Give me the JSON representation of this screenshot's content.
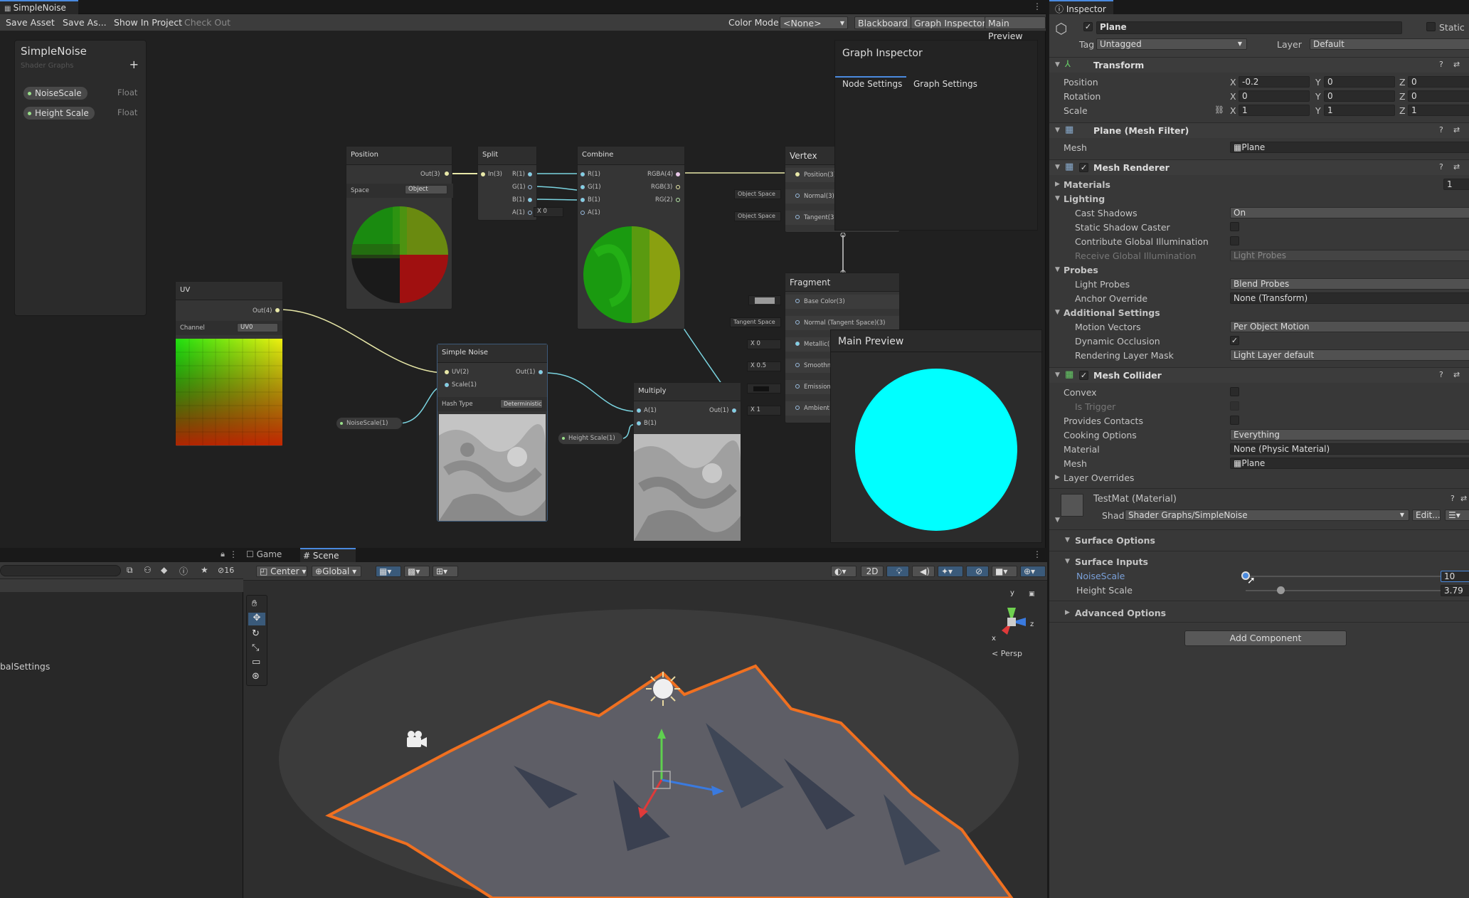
{
  "shadergraph": {
    "tab_title": "SimpleNoise",
    "toolbar": {
      "save_asset": "Save Asset",
      "save_as": "Save As...",
      "show_in_project": "Show In Project",
      "check_out": "Check Out",
      "color_mode_label": "Color Mode",
      "color_mode_value": "<None>",
      "blackboard": "Blackboard",
      "graph_inspector": "Graph Inspector",
      "main_preview": "Main Preview"
    },
    "blackboard": {
      "title": "SimpleNoise",
      "subtitle": "Shader Graphs",
      "add": "+",
      "properties": [
        {
          "name": "NoiseScale",
          "type": "Float"
        },
        {
          "name": "Height Scale",
          "type": "Float"
        }
      ]
    },
    "nodes": {
      "position": {
        "title": "Position",
        "out": "Out(3)",
        "space_label": "Space",
        "space_value": "Object"
      },
      "split": {
        "title": "Split",
        "in": "In(3)",
        "r": "R(1)",
        "g": "G(1)",
        "b": "B(1)",
        "a": "A(1)",
        "x": "X",
        "xval": "0"
      },
      "combine": {
        "title": "Combine",
        "r": "R(1)",
        "g": "G(1)",
        "b": "B(1)",
        "a": "A(1)",
        "rgba": "RGBA(4)",
        "rgb": "RGB(3)",
        "rg": "RG(2)"
      },
      "vertex": {
        "title": "Vertex",
        "position": "Position(3)",
        "normal": "Normal(3)",
        "tangent": "Tangent(3)",
        "obj1": "Object Space",
        "obj2": "Object Space"
      },
      "fragment": {
        "title": "Fragment",
        "base_color": "Base Color(3)",
        "normal": "Normal (Tangent Space)(3)",
        "tangent_space": "Tangent Space",
        "metallic": "Metallic(1)",
        "smoothness": "Smoothness(1)",
        "emission": "Emission(3)",
        "ambient": "Ambient Occlusion(1)",
        "x": "X",
        "v0": "0",
        "v05": "0.5",
        "v1": "1"
      },
      "uv": {
        "title": "UV",
        "out": "Out(4)",
        "channel_label": "Channel",
        "channel_value": "UV0"
      },
      "simple_noise": {
        "title": "Simple Noise",
        "uv": "UV(2)",
        "scale": "Scale(1)",
        "out": "Out(1)",
        "hash_label": "Hash Type",
        "hash_value": "Deterministic"
      },
      "multiply": {
        "title": "Multiply",
        "a": "A(1)",
        "b": "B(1)",
        "out": "Out(1)"
      },
      "noisescale_prop": "NoiseScale(1)",
      "heightscale_prop": "Height Scale(1)"
    },
    "graph_inspector": {
      "title": "Graph Inspector",
      "tab_node": "Node Settings",
      "tab_graph": "Graph Settings"
    },
    "main_preview": {
      "title": "Main Preview",
      "color": "#00ffff"
    }
  },
  "hierarchy": {
    "search_count": "16",
    "item": "balSettings"
  },
  "scene": {
    "tab_game": "Game",
    "tab_scene": "Scene",
    "pivot": "Center",
    "space": "Global",
    "mode_2d": "2D",
    "persp": "< Persp",
    "axis_y": "y",
    "axis_z": "z",
    "axis_x": "x"
  },
  "inspector": {
    "tab": "Inspector",
    "object_name": "Plane",
    "static_label": "Static",
    "tag_label": "Tag",
    "tag_value": "Untagged",
    "layer_label": "Layer",
    "layer_value": "Default",
    "transform": {
      "title": "Transform",
      "position_label": "Position",
      "pos": [
        "-0.2",
        "0",
        "0"
      ],
      "rotation_label": "Rotation",
      "rot": [
        "0",
        "0",
        "0"
      ],
      "scale_label": "Scale",
      "scl": [
        "1",
        "1",
        "1"
      ],
      "x": "X",
      "y": "Y",
      "z": "Z"
    },
    "mesh_filter": {
      "title": "Plane (Mesh Filter)",
      "mesh_label": "Mesh",
      "mesh_value": "Plane"
    },
    "mesh_renderer": {
      "title": "Mesh Renderer",
      "materials": "Materials",
      "materials_count": "1",
      "lighting": "Lighting",
      "cast_shadows": "Cast Shadows",
      "cast_shadows_value": "On",
      "static_shadow": "Static Shadow Caster",
      "contribute_gi": "Contribute Global Illumination",
      "receive_gi": "Receive Global Illumination",
      "receive_gi_value": "Light Probes",
      "probes": "Probes",
      "light_probes": "Light Probes",
      "light_probes_value": "Blend Probes",
      "anchor": "Anchor Override",
      "anchor_value": "None (Transform)",
      "additional": "Additional Settings",
      "motion": "Motion Vectors",
      "motion_value": "Per Object Motion",
      "dynamic_occlusion": "Dynamic Occlusion",
      "rendering_layer": "Rendering Layer Mask",
      "rendering_layer_value": "Light Layer default"
    },
    "mesh_collider": {
      "title": "Mesh Collider",
      "convex": "Convex",
      "is_trigger": "Is Trigger",
      "provides_contacts": "Provides Contacts",
      "cooking": "Cooking Options",
      "cooking_value": "Everything",
      "material": "Material",
      "material_value": "None (Physic Material)",
      "mesh": "Mesh",
      "mesh_value": "Plane",
      "layer_overrides": "Layer Overrides"
    },
    "material": {
      "title": "TestMat (Material)",
      "shader_label": "Shader",
      "shader_value": "Shader Graphs/SimpleNoise",
      "edit": "Edit...",
      "surface_options": "Surface Options",
      "surface_inputs": "Surface Inputs",
      "noise_scale": "NoiseScale",
      "noise_scale_value": "10",
      "noise_scale_slider": 0.0,
      "height_scale": "Height Scale",
      "height_scale_value": "3.79",
      "height_scale_slider": 0.2,
      "advanced": "Advanced Options"
    },
    "add_component": "Add Component"
  }
}
